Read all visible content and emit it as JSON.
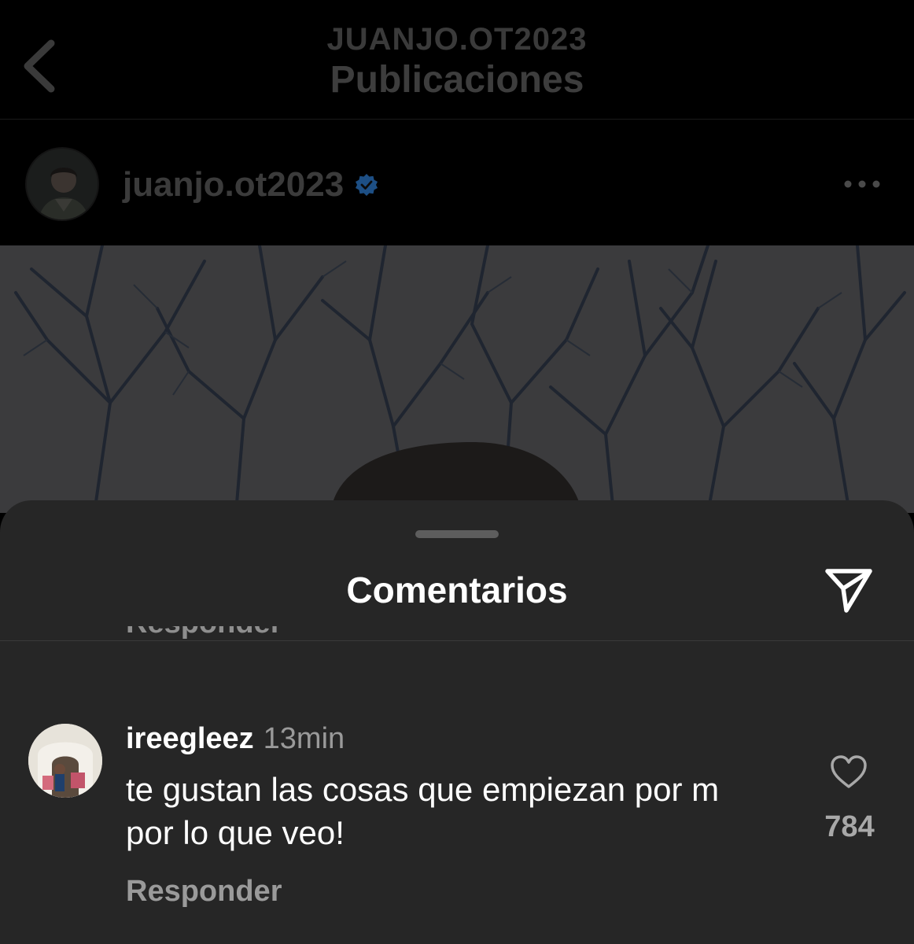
{
  "header": {
    "account": "JUANJO.OT2023",
    "title": "Publicaciones",
    "back_icon": "chevron-left-icon"
  },
  "post": {
    "username": "juanjo.ot2023",
    "verified": true,
    "more_icon": "more-horizontal-icon",
    "image_description_icon": "photo"
  },
  "comments_sheet": {
    "title": "Comentarios",
    "share_icon": "send-icon",
    "clipped_text": "Responder",
    "comments": [
      {
        "username": "ireegleez",
        "time": "13min",
        "text": "te gustan las cosas que empiezan por m por lo que veo!",
        "reply_label": "Responder",
        "like_icon": "heart-icon",
        "likes": "784"
      }
    ]
  },
  "colors": {
    "sheet_bg": "#262626",
    "text_primary": "#ffffff",
    "text_secondary": "#9a9a9a",
    "verified_blue": "#1d6fbf"
  }
}
